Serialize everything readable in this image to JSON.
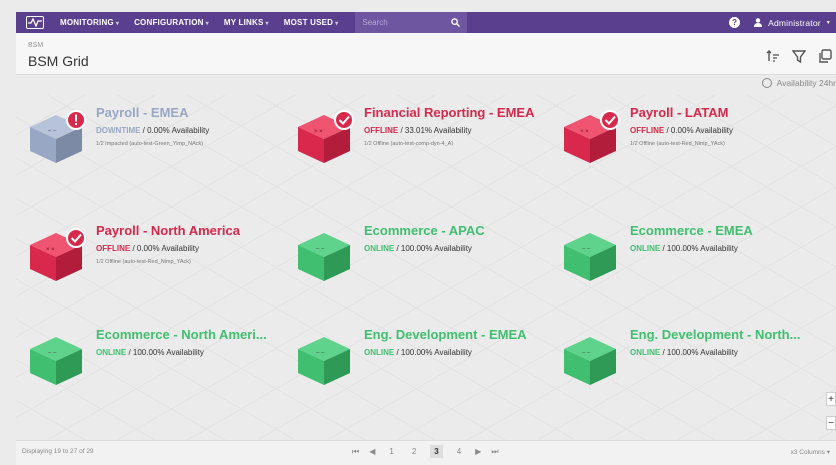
{
  "nav": {
    "items": [
      {
        "label": "Monitoring"
      },
      {
        "label": "Configuration"
      },
      {
        "label": "My Links"
      },
      {
        "label": "Most Used"
      }
    ],
    "search_placeholder": "Search",
    "user": "Administrator"
  },
  "header": {
    "breadcrumb": "BSM",
    "title": "BSM Grid",
    "availability": "Availability 24hr"
  },
  "colors": {
    "brand": "#5b3f8f",
    "online": "#3fbf6f",
    "offline": "#d8284b",
    "downtime": "#98a7c4"
  },
  "tiles": [
    {
      "name": "Payroll - EMEA",
      "status": "DOWNTIME",
      "availability": " / 0.00% Availability",
      "detail": "1/2 Impacted (auto-test-Green_Yimp_NAck)",
      "state": "downtime"
    },
    {
      "name": "Financial Reporting - EMEA",
      "status": "OFFLINE",
      "availability": " / 33.01% Availability",
      "detail": "1/2 Offline (auto-test-comp-dyn-4_A)",
      "state": "offline"
    },
    {
      "name": "Payroll - LATAM",
      "status": "OFFLINE",
      "availability": " / 0.00% Availability",
      "detail": "1/2 Offline (auto-test-Red_Nimp_YAck)",
      "state": "offline"
    },
    {
      "name": "Payroll - North America",
      "status": "OFFLINE",
      "availability": " / 0.00% Availability",
      "detail": "1/2 Offline (auto-test-Red_Nimp_YAck)",
      "state": "offline"
    },
    {
      "name": "Ecommerce - APAC",
      "status": "ONLINE",
      "availability": " / 100.00% Availability",
      "detail": "",
      "state": "online"
    },
    {
      "name": "Ecommerce - EMEA",
      "status": "ONLINE",
      "availability": " / 100.00% Availability",
      "detail": "",
      "state": "online"
    },
    {
      "name": "Ecommerce - North Ameri...",
      "status": "ONLINE",
      "availability": " / 100.00% Availability",
      "detail": "",
      "state": "online"
    },
    {
      "name": "Eng. Development - EMEA",
      "status": "ONLINE",
      "availability": " / 100.00% Availability",
      "detail": "",
      "state": "online"
    },
    {
      "name": "Eng. Development - North...",
      "status": "ONLINE",
      "availability": " / 100.00% Availability",
      "detail": "",
      "state": "online"
    }
  ],
  "footer": {
    "displaying": "Displaying 19 to 27 of 29",
    "pages": [
      "1",
      "2",
      "3",
      "4"
    ],
    "current_page": "3",
    "columns": "x3 Columns"
  }
}
